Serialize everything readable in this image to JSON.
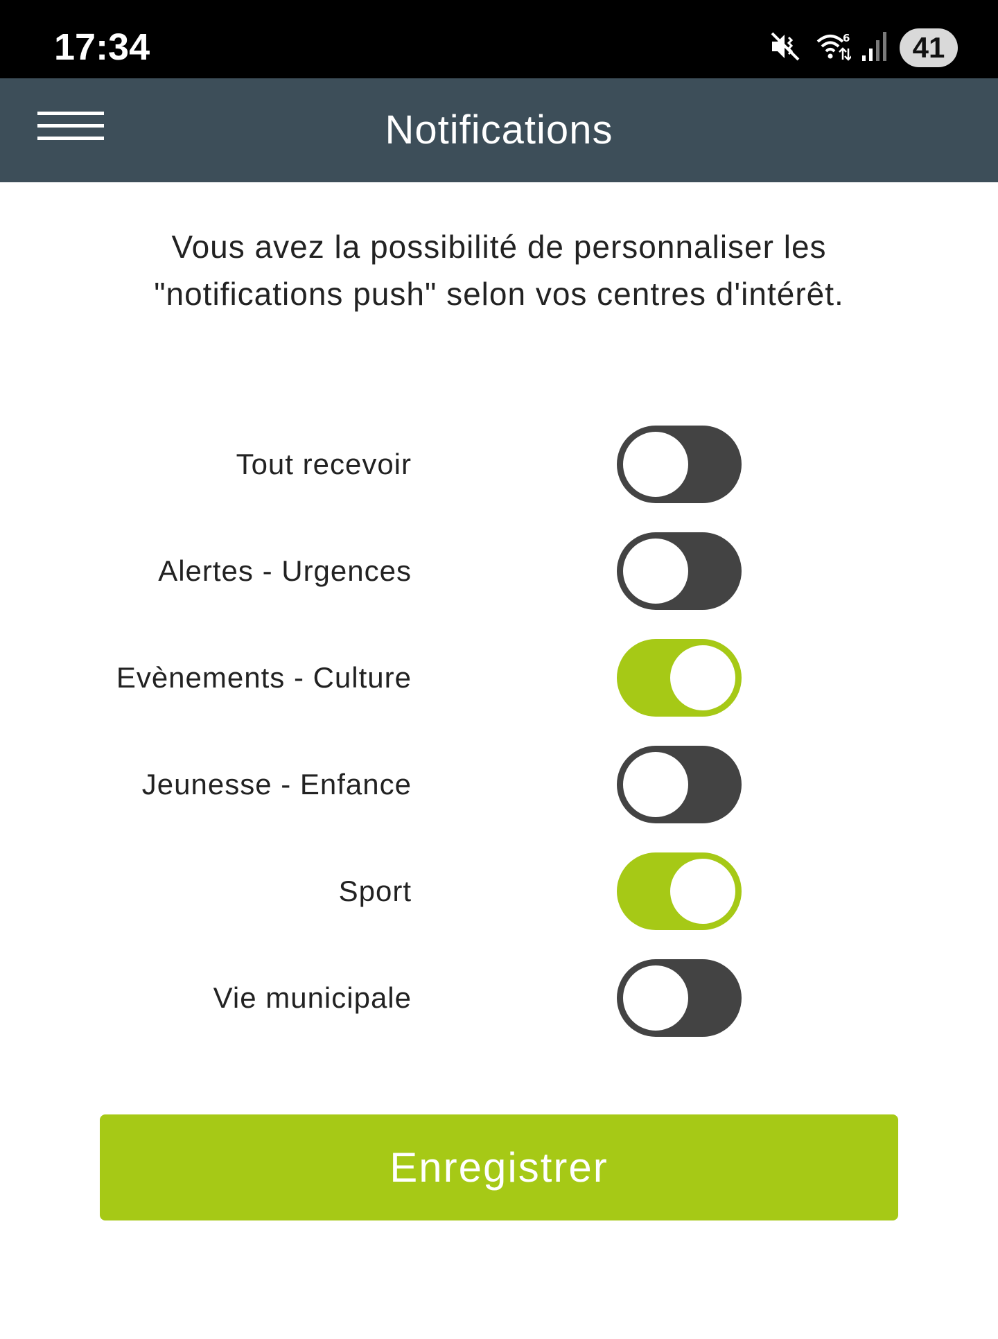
{
  "status_bar": {
    "time": "17:34",
    "battery": "41",
    "icons": [
      "vibrate-mute-icon",
      "wifi-icon",
      "signal-icon"
    ]
  },
  "app_bar": {
    "title": "Notifications",
    "menu_icon": "hamburger-menu-icon"
  },
  "intro": {
    "line1": "Vous avez la possibilité de personnaliser les",
    "line2": "\"notifications push\" selon vos centres d'intérêt."
  },
  "preferences": [
    {
      "label": "Tout recevoir",
      "enabled": false
    },
    {
      "label": "Alertes - Urgences",
      "enabled": false
    },
    {
      "label": "Evènements - Culture",
      "enabled": true
    },
    {
      "label": "Jeunesse - Enfance",
      "enabled": false
    },
    {
      "label": "Sport",
      "enabled": true
    },
    {
      "label": "Vie municipale",
      "enabled": false
    }
  ],
  "save_label": "Enregistrer",
  "colors": {
    "accent": "#a6c916",
    "app_bar": "#3d4e59",
    "toggle_off": "#434343"
  }
}
